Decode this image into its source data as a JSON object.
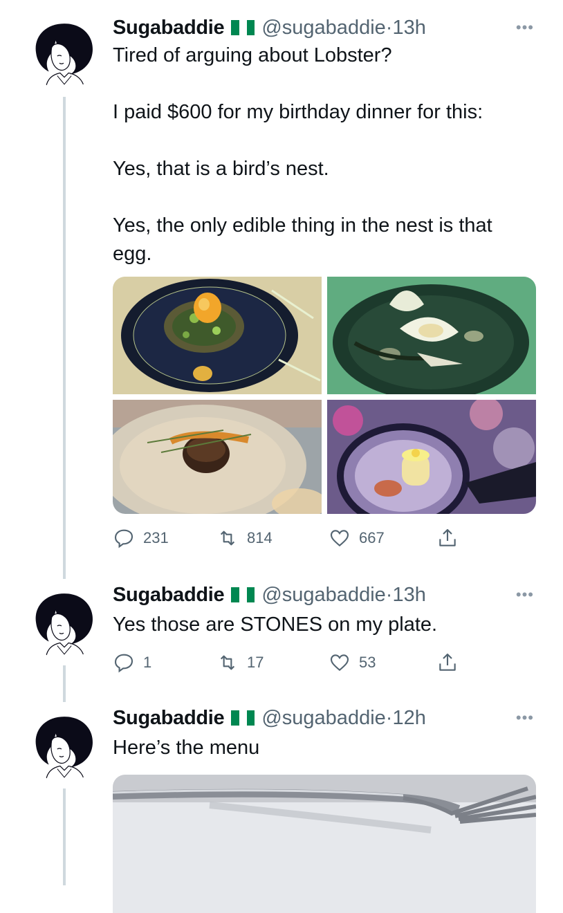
{
  "tweets": [
    {
      "name": "Sugabaddie",
      "handle": "@sugabaddie",
      "time": "13h",
      "text": "Tired of arguing about Lobster?\n\nI paid $600 for my birthday dinner for this:\n\nYes, that is a bird’s nest.\n\nYes, the only edible thing in the nest is that\negg.",
      "replies": "231",
      "retweets": "814",
      "likes": "667",
      "photos": [
        "bird's nest dish with egg",
        "shells and stones dish",
        "meat dish with herbs",
        "dessert cylinder dish"
      ]
    },
    {
      "name": "Sugabaddie",
      "handle": "@sugabaddie",
      "time": "13h",
      "text": "Yes those are STONES on my plate.",
      "replies": "1",
      "retweets": "17",
      "likes": "53"
    },
    {
      "name": "Sugabaddie",
      "handle": "@sugabaddie",
      "time": "12h",
      "text": "Here’s the menu",
      "photo": "fork on white tablecloth"
    }
  ],
  "separator": " · ",
  "more_glyph": "•••",
  "colors": {
    "flag_green": "#008751",
    "thread_line": "#cfd9de",
    "secondary_text": "#536471"
  },
  "icons": {
    "reply": "reply-icon",
    "retweet": "retweet-icon",
    "like": "heart-icon",
    "share": "share-icon",
    "more": "more-icon"
  }
}
